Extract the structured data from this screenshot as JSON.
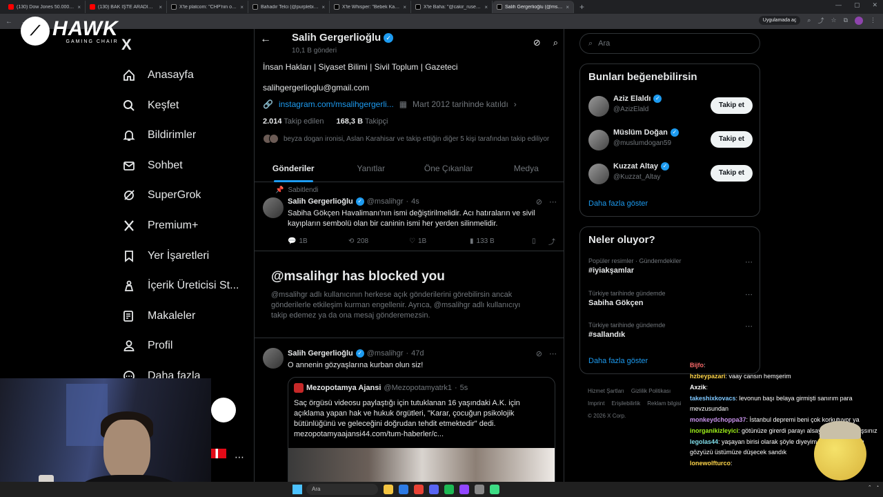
{
  "browser": {
    "tabs": [
      {
        "label": "(130) Dow Jones 50.000 Oldu !",
        "fav": "yt",
        "active": false
      },
      {
        "label": "(130) BAK İŞTE ARADIĞIM OYU",
        "fav": "yt",
        "active": false
      },
      {
        "label": "X'te platcom: \"CHP'nin oyunla",
        "fav": "x",
        "active": false
      },
      {
        "label": "Bahadır Telci (@purplebisi) / X",
        "fav": "x",
        "active": false
      },
      {
        "label": "X'te Whisper: \"Bebek Katili Abd",
        "fav": "x",
        "active": false
      },
      {
        "label": "X'te Baha: \"@cakir_rusen @Ka",
        "fav": "x",
        "active": false
      },
      {
        "label": "Salih Gergerlioğlu (@msalihgr",
        "fav": "x",
        "active": true
      }
    ],
    "new_tab": "+",
    "address_pill": "Uygulamada aç"
  },
  "overlay_logo": {
    "brand": "HAWK",
    "sub": "GAMING CHAIR"
  },
  "nav": {
    "logo": "X",
    "items": [
      {
        "label": "Anasayfa",
        "icon": "home-icon"
      },
      {
        "label": "Keşfet",
        "icon": "search-icon"
      },
      {
        "label": "Bildirimler",
        "icon": "bell-icon"
      },
      {
        "label": "Sohbet",
        "icon": "mail-icon"
      },
      {
        "label": "SuperGrok",
        "icon": "grok-icon"
      },
      {
        "label": "Premium+",
        "icon": "x-premium-icon"
      },
      {
        "label": "Yer İşaretleri",
        "icon": "bookmark-icon"
      },
      {
        "label": "İçerik Üreticisi St...",
        "icon": "creator-icon"
      },
      {
        "label": "Makaleler",
        "icon": "article-icon"
      },
      {
        "label": "Profil",
        "icon": "profile-icon"
      },
      {
        "label": "Daha fazla",
        "icon": "more-icon"
      }
    ]
  },
  "profile": {
    "name": "Salih Gergerlioğlu",
    "posts": "10,1 B gönderi",
    "bio": "İnsan Hakları | Siyaset Bilimi | Sivil Toplum | Gazeteci",
    "email": "salihgergerlioglu@gmail.com",
    "link": "instagram.com/msalihgergerli...",
    "joined": "Mart 2012 tarihinde katıldı",
    "following_count": "2.014",
    "following_label": "Takip edilen",
    "followers_count": "168,3 B",
    "followers_label": "Takipçi",
    "followed_by": "beyza dogan ironisi, Aslan Karahisar ve takip ettiğin diğer 5 kişi tarafından takip ediliyor",
    "tabs": [
      "Gönderiler",
      "Yanıtlar",
      "Öne Çıkanlar",
      "Medya"
    ]
  },
  "pinned_tweet": {
    "pinned_label": "Sabitlendi",
    "name": "Salih Gergerlioğlu",
    "handle": "@msalihgr",
    "time": "4s",
    "text": "Sabiha Gökçen Havalimanı'nın ismi değiştirilmelidir. Acı hatıraların ve sivil kayıpların sembolü olan bir caninin ismi her yerden silinmelidir.",
    "replies": "1B",
    "reposts": "208",
    "likes": "1B",
    "views": "133 B"
  },
  "blocked": {
    "title": "@msalihgr has blocked you",
    "body": "@msalihgr adlı kullanıcının herkese açık gönderilerini görebilirsin ancak gönderilerle etkileşim kurman engellenir. Ayrıca, @msalihgr adlı kullanıcıyı takip edemez ya da ona mesaj gönderemezsin."
  },
  "second_tweet": {
    "name": "Salih Gergerlioğlu",
    "handle": "@msalihgr",
    "time": "47d",
    "text": "O annenin gözyaşlarına kurban olun siz!",
    "quote": {
      "name": "Mezopotamya Ajansi",
      "handle": "@Mezopotamyatrk1",
      "time": "5s",
      "text": "Saç örgüsü videosu paylaştığı için tutuklanan 16 yaşındaki A.K. için açıklama yapan hak ve hukuk örgütleri, \"Karar, çocuğun psikolojik bütünlüğünü ve geleceğini doğrudan tehdit etmektedir\" dedi. mezopotamyaajansi44.com/tum-haberler/c..."
    }
  },
  "right": {
    "search_placeholder": "Ara",
    "suggest_title": "Bunları beğenebilirsin",
    "suggestions": [
      {
        "name": "Aziz Elaldı",
        "handle": "@AzizElald",
        "button": "Takip et"
      },
      {
        "name": "Müslüm Doğan",
        "handle": "@muslumdogan59",
        "button": "Takip et"
      },
      {
        "name": "Kuzzat Altay",
        "handle": "@Kuzzat_Altay",
        "button": "Takip et"
      }
    ],
    "show_more": "Daha fazla göster",
    "trends_title": "Neler oluyor?",
    "trends": [
      {
        "context": "Popüler resimler · Gündemdekiler",
        "topic": "#iyiakşamlar"
      },
      {
        "context": "Türkiye tarihinde gündemde",
        "topic": "Sabiha Gökçen"
      },
      {
        "context": "Türkiye tarihinde gündemde",
        "topic": "#sallandık"
      }
    ],
    "footer": [
      "Hizmet Şartları",
      "Gizlilik Politikası",
      "Imprint",
      "Erişilebilirlik",
      "Reklam bilgisi",
      "© 2026 X Corp."
    ]
  },
  "chat": [
    {
      "user": "Bijfo",
      "text": ": ",
      "color": "#ff6b6b"
    },
    {
      "user": "hzbeypazari",
      "text": ": vaay cansın hemşerim",
      "color": "#ffd54a"
    },
    {
      "user": "Axzik",
      "text": ": ",
      "color": "#ffffff"
    },
    {
      "user": "takeshixkovacs",
      "text": ": levonun başı belaya girmişti sanırım para mevzusundan",
      "color": "#7ec8ff"
    },
    {
      "user": "monkeydchoppa37",
      "text": ": İstanbul depremi beni çok korkutuyor ya",
      "color": "#c792ea"
    },
    {
      "user": "inorganikizleyici",
      "text": ": götünüze girerdi parayı alsaydınız iyi yapmışsınız",
      "color": "#9ef01a"
    },
    {
      "user": "legolas44",
      "text": ": yaşayan birisi olarak şöyle diyeyim başka gerçekten gözyüzü üstümüze düşecek sandık",
      "color": "#80deea"
    },
    {
      "user": "lonewolfturco",
      "text": ": ",
      "color": "#ffd54a"
    }
  ],
  "taskbar": {
    "search": "Ara"
  }
}
